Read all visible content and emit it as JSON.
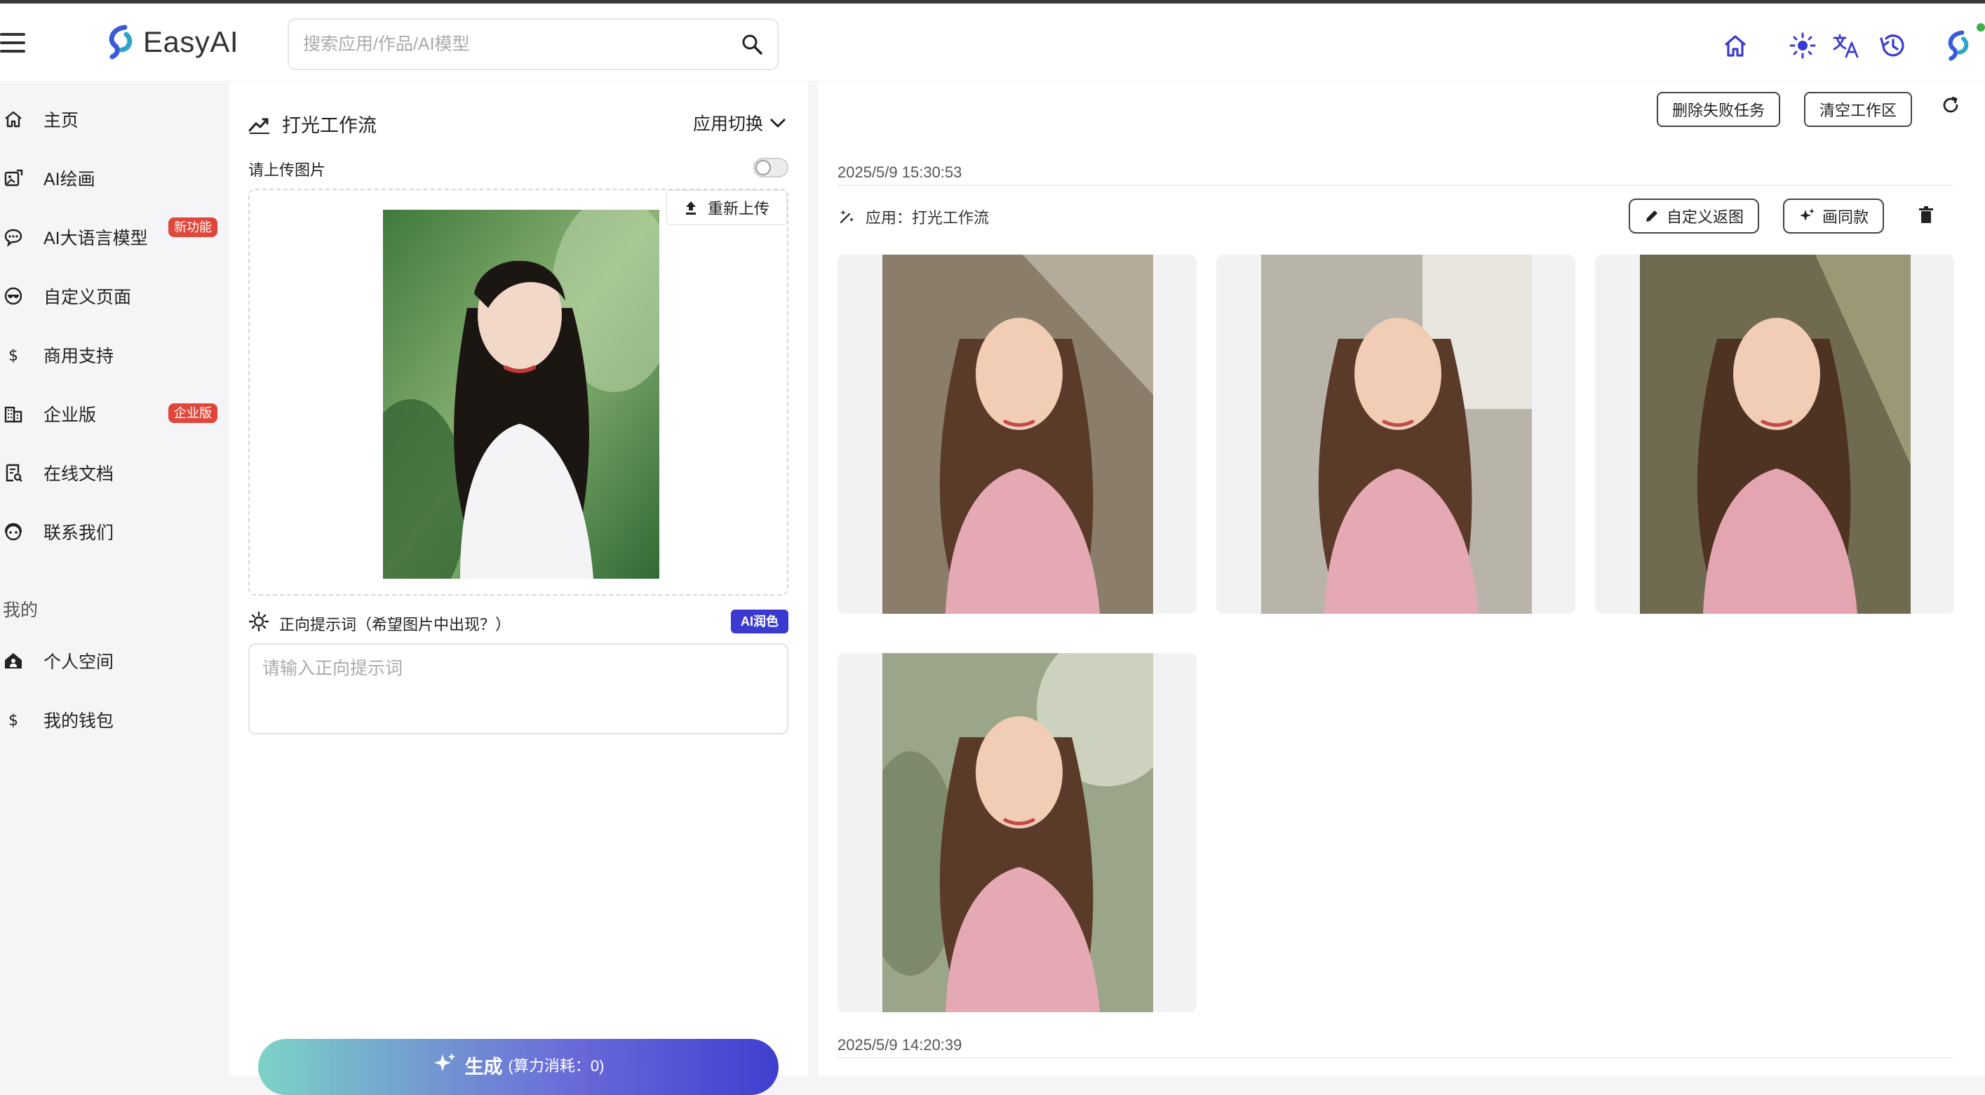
{
  "app": {
    "name": "EasyAI"
  },
  "search": {
    "placeholder": "搜索应用/作品/AI模型"
  },
  "header_icons": [
    "home-icon",
    "theme-sun-icon",
    "translate-icon",
    "history-icon",
    "avatar-logo-icon"
  ],
  "sidebar": {
    "items": [
      {
        "label": "主页",
        "icon": "home-icon"
      },
      {
        "label": "AI绘画",
        "icon": "image-icon"
      },
      {
        "label": "AI大语言模型",
        "icon": "chat-icon",
        "badge": "新功能"
      },
      {
        "label": "自定义页面",
        "icon": "mask-icon"
      },
      {
        "label": "商用支持",
        "icon": "dollar-icon"
      },
      {
        "label": "企业版",
        "icon": "building-icon",
        "badge": "企业版"
      },
      {
        "label": "在线文档",
        "icon": "document-icon"
      },
      {
        "label": "联系我们",
        "icon": "support-icon"
      }
    ],
    "section_mine": "我的",
    "mine_items": [
      {
        "label": "个人空间",
        "icon": "person-home-icon"
      },
      {
        "label": "我的钱包",
        "icon": "dollar-icon"
      }
    ]
  },
  "form": {
    "title": "打光工作流",
    "app_switch": "应用切换",
    "upload_label": "请上传图片",
    "reupload": "重新上传",
    "prompt_label": "正向提示词（希望图片中出现？）",
    "ai_polish": "AI润色",
    "prompt_placeholder": "请输入正向提示词",
    "prompt_value": "",
    "generate": "生成",
    "generate_cost": "(算力消耗：0)"
  },
  "workspace": {
    "delete_failed": "删除失败任务",
    "clear": "清空工作区",
    "tasks": [
      {
        "timestamp": "2025/5/9 15:30:53",
        "app_label": "应用：打光工作流",
        "custom_back": "自定义返图",
        "same_style": "画同款",
        "image_count": 4
      },
      {
        "timestamp": "2025/5/9 14:20:39"
      }
    ]
  },
  "colors": {
    "accent": "#3a3ad1",
    "badge_red": "#e0473a",
    "generate_gradient_start": "#7dd3c7",
    "generate_gradient_end": "#3f3fd0",
    "online_dot": "#3bb54a"
  }
}
